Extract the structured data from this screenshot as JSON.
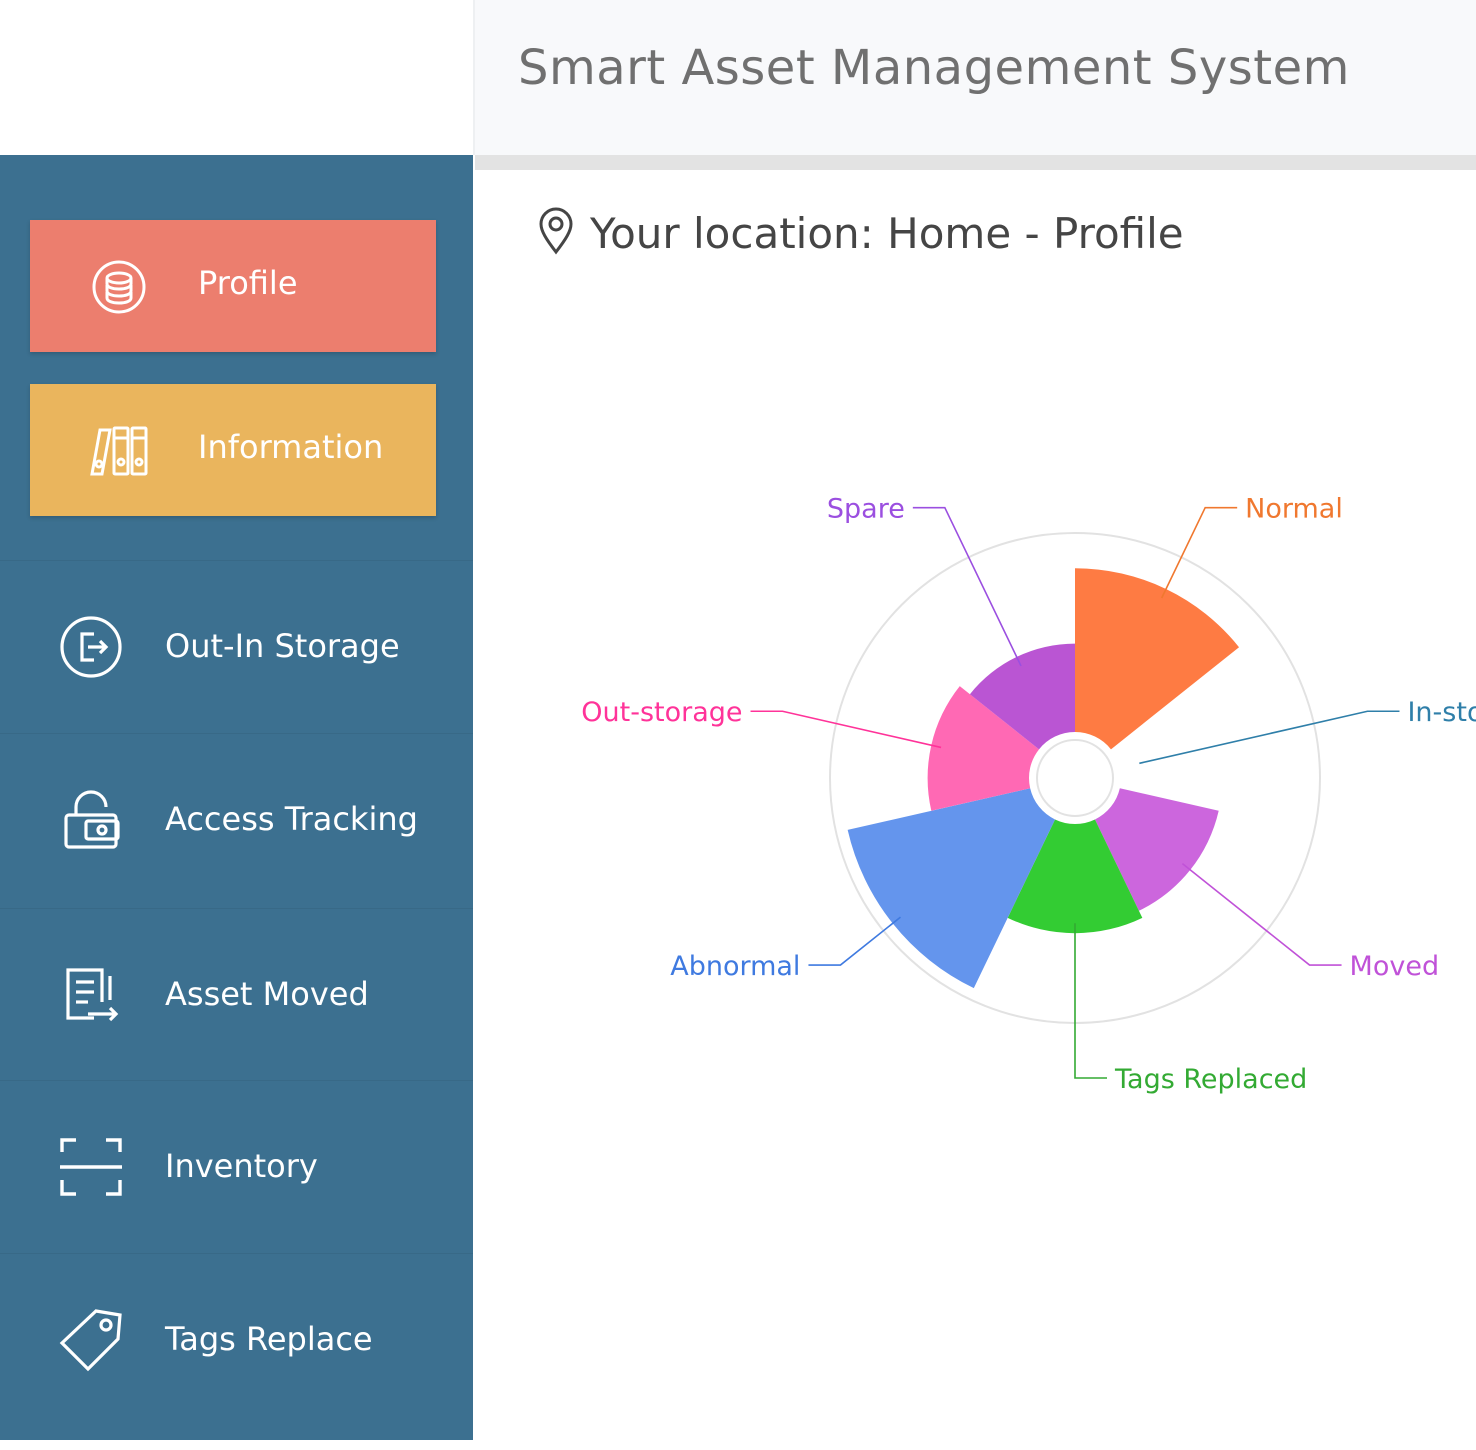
{
  "app": {
    "title": "Smart Asset Management System"
  },
  "breadcrumb": {
    "text": "Your location: Home - Profile"
  },
  "sidebar": {
    "cards": [
      {
        "label": "Profile",
        "icon": "coins-stack-icon",
        "color": "#ec7e6e"
      },
      {
        "label": "Information",
        "icon": "binders-icon",
        "color": "#eab55d"
      }
    ],
    "items": [
      {
        "label": "Out-In Storage",
        "icon": "exit-circle-icon"
      },
      {
        "label": "Access Tracking",
        "icon": "open-lock-icon"
      },
      {
        "label": "Asset Moved",
        "icon": "document-arrow-icon"
      },
      {
        "label": "Inventory",
        "icon": "scan-frame-icon"
      },
      {
        "label": "Tags Replace",
        "icon": "tag-icon"
      }
    ]
  },
  "colors": {
    "sidebar": "#3c7090"
  },
  "chart_data": {
    "type": "nightingale-rose",
    "categories": [
      "Normal",
      "In-storage",
      "Moved",
      "Tags Replaced",
      "Abnormal",
      "Out-storage",
      "Spare"
    ],
    "values": [
      6.3,
      0,
      3.9,
      4.2,
      7.2,
      3.9,
      3.4
    ],
    "colors": [
      "#fe7b43",
      "#7ec8e3",
      "#cc66dd",
      "#33cc33",
      "#6495ed",
      "#ff69b4",
      "#ba55d3"
    ],
    "label_colors": [
      "#f0782f",
      "#2f7fa9",
      "#c052d8",
      "#33aa33",
      "#3f7ae0",
      "#ff3399",
      "#9b4fe0"
    ]
  }
}
